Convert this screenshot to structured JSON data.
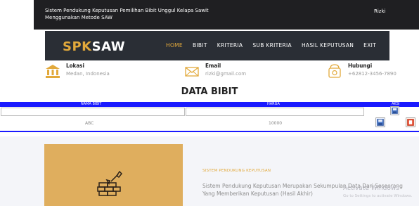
{
  "header": {
    "system_title": "Sistem Pendukung Keputusan Pemilihan Bibit Unggul Kelapa Sawit Menggunakan Metode SAW",
    "user": "Rizki"
  },
  "navbar": {
    "logo_a": "SPK",
    "logo_b": "SAW",
    "items": [
      "HOME",
      "BIBIT",
      "KRITERIA",
      "SUB KRITERIA",
      "HASIL KEPUTUSAN",
      "EXIT"
    ],
    "active": "HOME"
  },
  "contact": {
    "location": {
      "label": "Lokasi",
      "value": "Medan, Indonesia",
      "icon": "bank-icon"
    },
    "email": {
      "label": "Email",
      "value": "rizki@gmail.com",
      "icon": "envelope-icon"
    },
    "phone": {
      "label": "Hubungi",
      "value": "+62812-3456-7890",
      "icon": "phone-icon"
    }
  },
  "table": {
    "title": "DATA BIBIT",
    "columns": [
      "NAMA BIBIT",
      "HARGA",
      "AKSI"
    ],
    "input_row": {
      "nama": "",
      "harga": ""
    },
    "rows": [
      {
        "nama": "ABC",
        "harga": "10000"
      }
    ]
  },
  "section": {
    "kicker": "SISTEM PENDUKUNG KEPUTUSAN",
    "text": "Sistem Pendukung Keputusan Merupakan Sekumpulan Data Dari Seseorang Yang Memberikan Keputusan (Hasil Akhir)"
  },
  "watermark": {
    "line1": "Activate Windows",
    "line2": "Go to Settings to activate Windows."
  },
  "colors": {
    "accent": "#e2a93b",
    "table_header": "#1a1aff",
    "dark_bar": "#1f1f22"
  }
}
